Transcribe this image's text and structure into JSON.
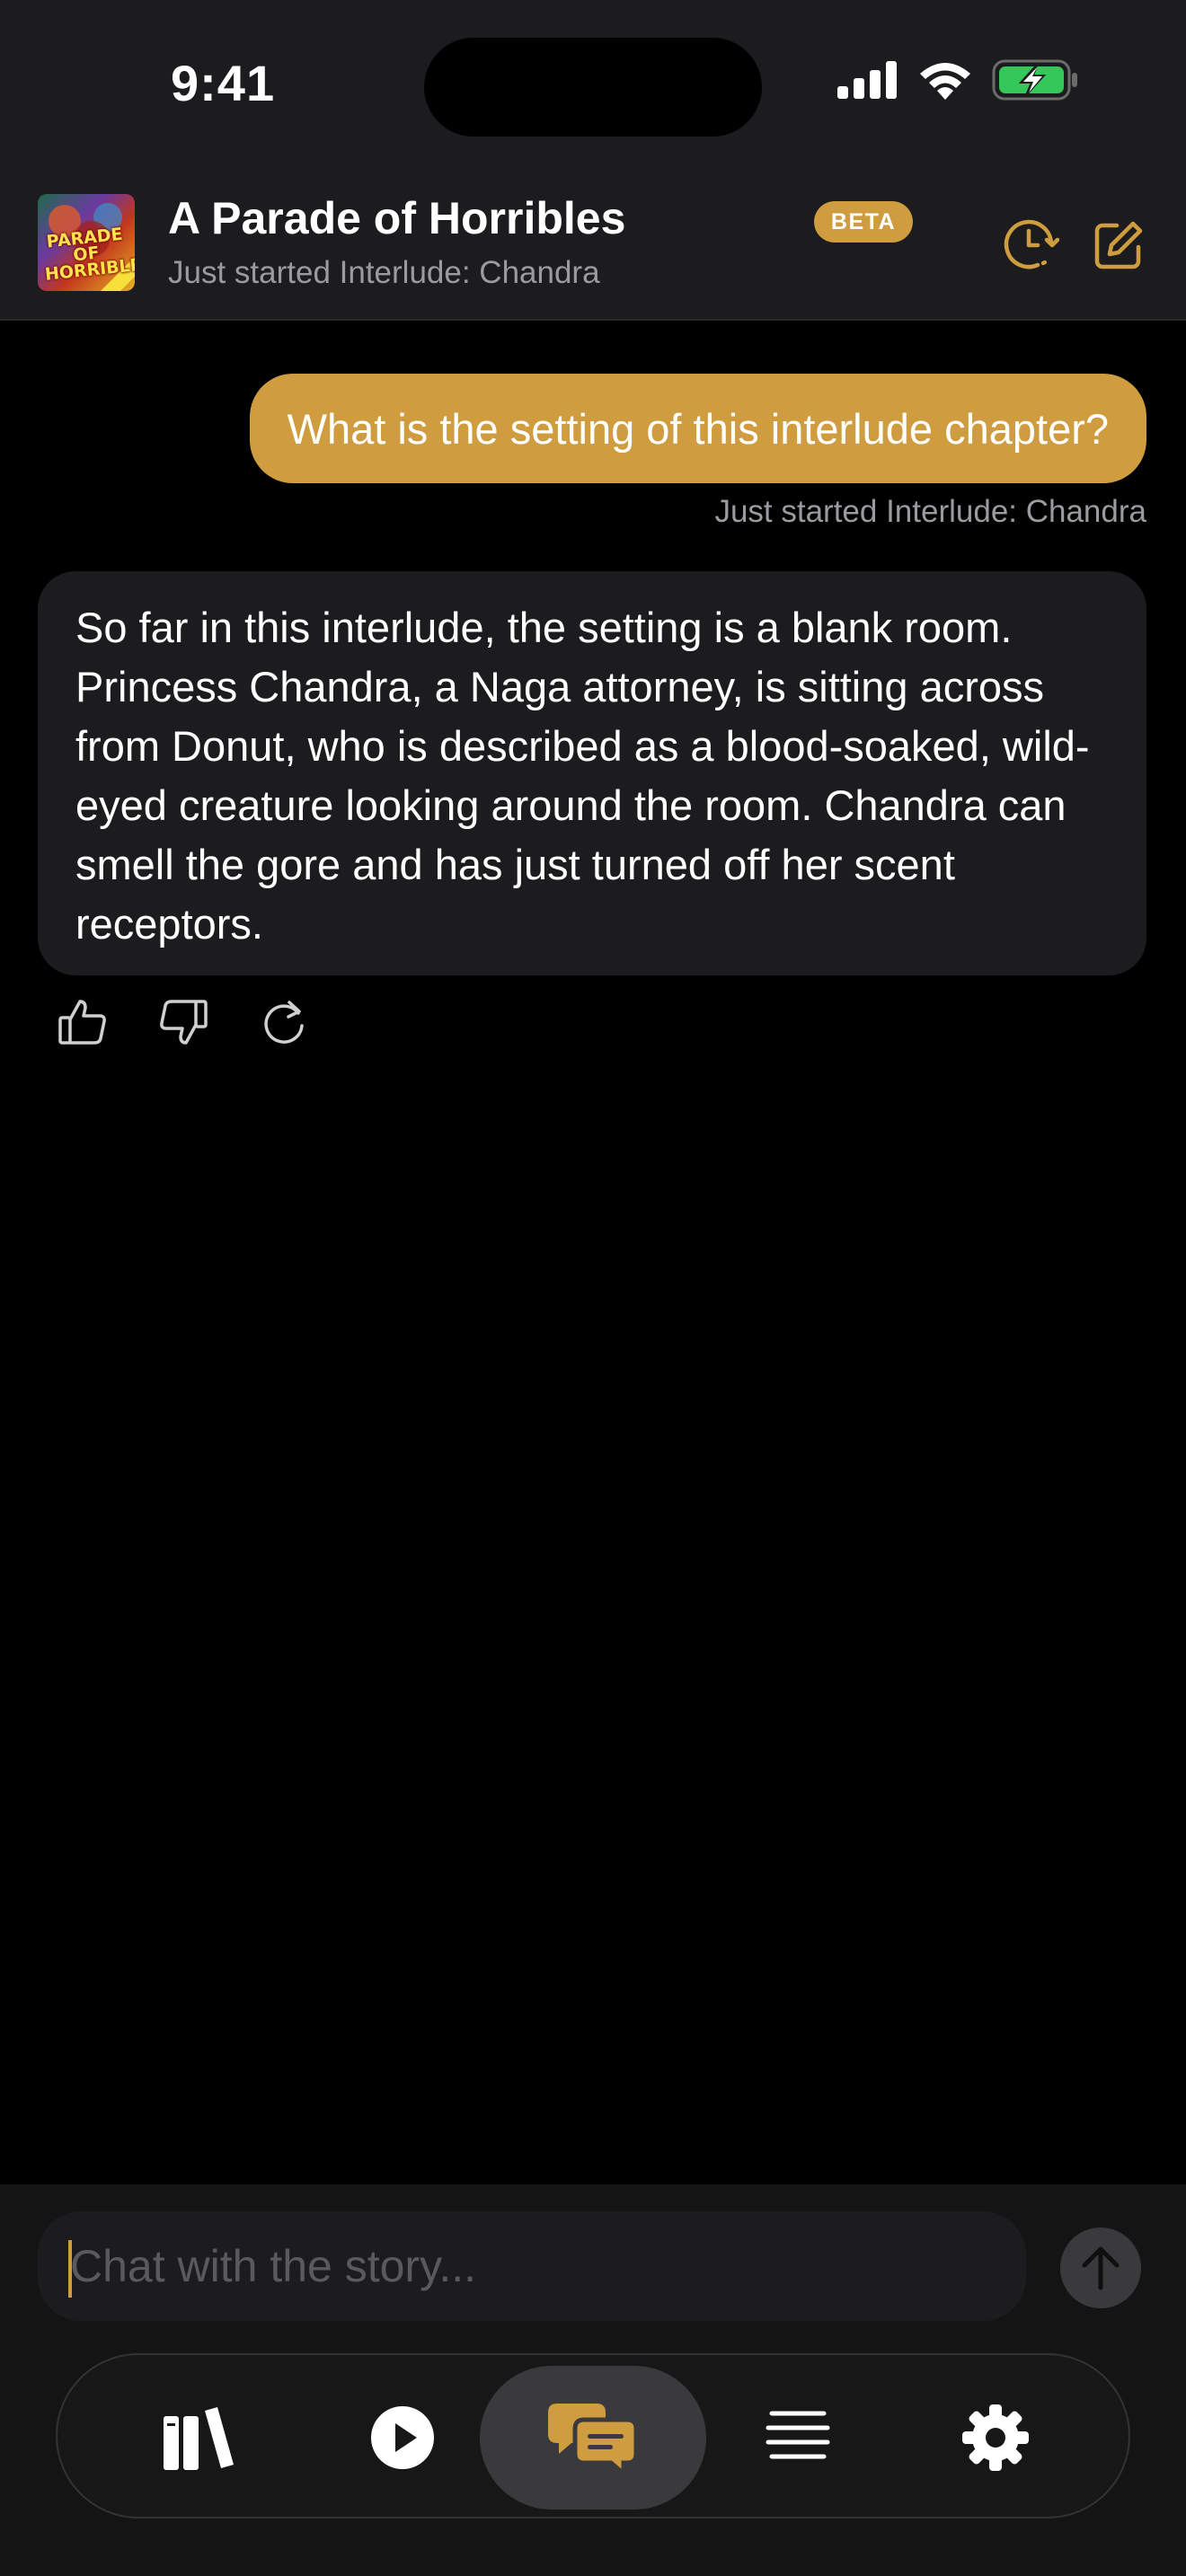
{
  "status_bar": {
    "time": "9:41",
    "icons": [
      "cellular-icon",
      "wifi-icon",
      "battery-charging-icon"
    ],
    "battery_color": "#34c759"
  },
  "header": {
    "cover_art_text": "PARADE OF HORRIBLES",
    "title": "A Parade of Horribles",
    "subtitle": "Just started Interlude: Chandra",
    "badge": "BETA",
    "actions": [
      "history-icon",
      "compose-icon"
    ]
  },
  "messages": [
    {
      "role": "user",
      "text": "What is the setting of this interlude chapter?",
      "meta": "Just started Interlude: Chandra"
    },
    {
      "role": "assistant",
      "text": "So far in this interlude, the setting is a blank room. Princess Chandra, a Naga attorney, is sitting across from Donut, who is described as a blood-soaked, wild-eyed creature looking around the room. Chandra can smell the gore and has just turned off her scent receptors.",
      "actions": [
        "thumbs-up-icon",
        "thumbs-down-icon",
        "regenerate-icon"
      ]
    }
  ],
  "composer": {
    "placeholder": "Chat with the story...",
    "value": ""
  },
  "tabs": [
    {
      "icon": "library-icon",
      "active": false
    },
    {
      "icon": "play-icon",
      "active": false
    },
    {
      "icon": "chat-icon",
      "active": true
    },
    {
      "icon": "text-lines-icon",
      "active": false
    },
    {
      "icon": "settings-gear-icon",
      "active": false
    }
  ],
  "colors": {
    "accent": "#cf9d3f",
    "background": "#000000",
    "surface": "#1c1c1e",
    "muted_text": "#9a9a9f"
  }
}
